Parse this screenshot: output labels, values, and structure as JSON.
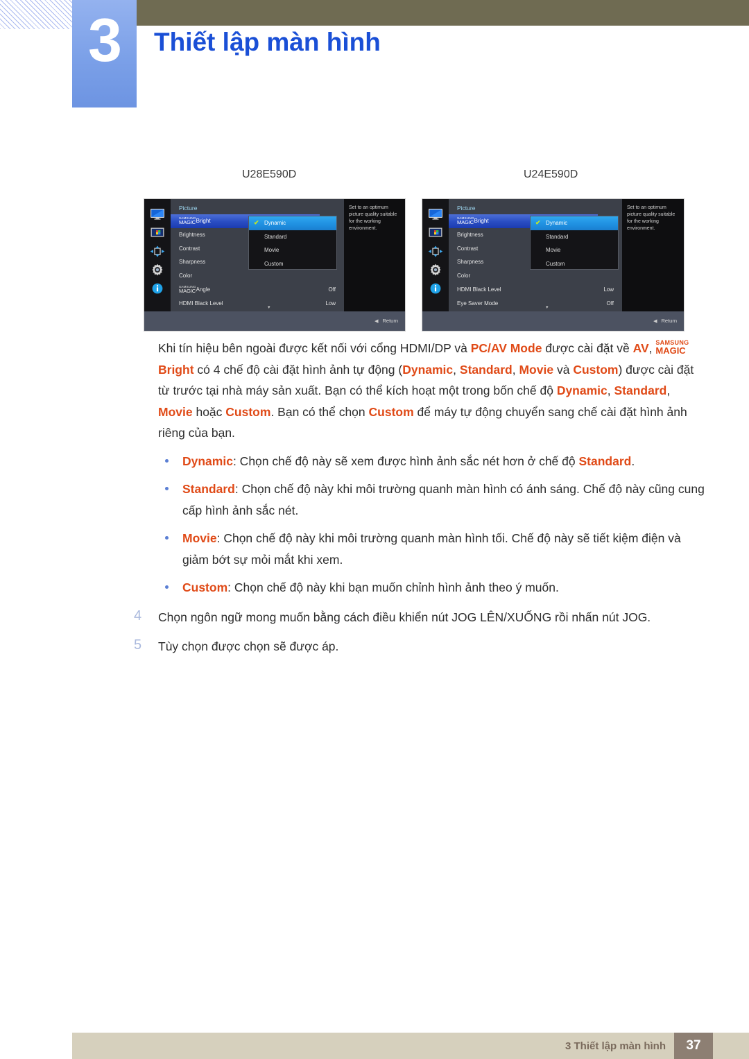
{
  "header": {
    "chapter_number": "3",
    "chapter_title": "Thiết lập màn hình",
    "accent_blue": "#1a4fd6",
    "box_blue": "#7ba0e8",
    "olive": "#6f6b52"
  },
  "models": {
    "left": "U28E590D",
    "right": "U24E590D"
  },
  "osd_left": {
    "title": "Picture",
    "rail_icons": [
      "monitor-icon",
      "picture-icon",
      "arrows-icon",
      "gear-icon",
      "info-icon"
    ],
    "rows": [
      {
        "label_small": "SAMSUNG",
        "label_big": "MAGIC",
        "suffix": "Bright",
        "value": "",
        "selected": true
      },
      {
        "label_small": "",
        "label_big": "",
        "suffix": "Brightness",
        "value": "",
        "selected": false
      },
      {
        "label_small": "",
        "label_big": "",
        "suffix": "Contrast",
        "value": "",
        "selected": false
      },
      {
        "label_small": "",
        "label_big": "",
        "suffix": "Sharpness",
        "value": "",
        "selected": false
      },
      {
        "label_small": "",
        "label_big": "",
        "suffix": "Color",
        "value": "",
        "selected": false
      },
      {
        "label_small": "SAMSUNG",
        "label_big": "MAGIC",
        "suffix": "Angle",
        "value": "Off",
        "selected": false
      },
      {
        "label_small": "",
        "label_big": "",
        "suffix": "HDMI Black Level",
        "value": "Low",
        "selected": false
      }
    ],
    "scroll_caret": "▾",
    "submenu": [
      {
        "label": "Dynamic",
        "checked": true
      },
      {
        "label": "Standard",
        "checked": false
      },
      {
        "label": "Movie",
        "checked": false
      },
      {
        "label": "Custom",
        "checked": false
      }
    ],
    "info_text": "Set to an optimum picture quality suitable for the working environment.",
    "return_label": "Return"
  },
  "osd_right": {
    "title": "Picture",
    "rail_icons": [
      "monitor-icon",
      "picture-icon",
      "arrows-icon",
      "gear-icon",
      "info-icon"
    ],
    "rows": [
      {
        "label_small": "SAMSUNG",
        "label_big": "MAGIC",
        "suffix": "Bright",
        "value": "",
        "selected": true
      },
      {
        "label_small": "",
        "label_big": "",
        "suffix": "Brightness",
        "value": "",
        "selected": false
      },
      {
        "label_small": "",
        "label_big": "",
        "suffix": "Contrast",
        "value": "",
        "selected": false
      },
      {
        "label_small": "",
        "label_big": "",
        "suffix": "Sharpness",
        "value": "",
        "selected": false
      },
      {
        "label_small": "",
        "label_big": "",
        "suffix": "Color",
        "value": "",
        "selected": false
      },
      {
        "label_small": "",
        "label_big": "",
        "suffix": "HDMI Black Level",
        "value": "Low",
        "selected": false
      },
      {
        "label_small": "",
        "label_big": "",
        "suffix": "Eye Saver Mode",
        "value": "Off",
        "selected": false
      }
    ],
    "scroll_caret": "▾",
    "submenu": [
      {
        "label": "Dynamic",
        "checked": true
      },
      {
        "label": "Standard",
        "checked": false
      },
      {
        "label": "Movie",
        "checked": false
      },
      {
        "label": "Custom",
        "checked": false
      }
    ],
    "info_text": "Set to an optimum picture quality suitable for the working environment.",
    "return_label": "Return"
  },
  "body": {
    "paragraph_lines": [
      "Khi tín hiệu bên ngoài được kết nối với cổng HDMI/DP và PC/AV Mode được cài đặt về AV,",
      "SAMSUNG MAGIC Bright có 4 chế độ cài đặt hình ảnh tự động (Dynamic, Standard, Movie và Custom)",
      "được cài đặt từ trước tại nhà máy sản xuất. Bạn có thể kích hoạt một trong bốn chế độ Dynamic,",
      "Standard, Movie hoặc Custom. Bạn có thể chọn Custom để máy tự động chuyển sang chế cài",
      "đặt hình ảnh riêng của bạn."
    ],
    "para_p1_a": "Khi tín hiệu bên ngoài được kết nối với cổng HDMI/DP và ",
    "para_p1_b": "PC/AV Mode",
    "para_p1_c": " được cài đặt về ",
    "para_p1_d": "AV",
    "para_p1_e": ", ",
    "magic_small": "SAMSUNG",
    "magic_big": "MAGIC",
    "magic_suffix": "Bright",
    "para_p2_a": " có 4 chế độ cài đặt hình ảnh tự động (",
    "para_p2_dynamic": "Dynamic",
    "para_p2_sep1": ", ",
    "para_p2_standard": "Standard",
    "para_p2_sep2": ", ",
    "para_p2_movie": "Movie",
    "para_p2_va": " và ",
    "para_p2_custom": "Custom",
    "para_p2_b": ") được cài đặt từ trước tại nhà máy sản xuất. Bạn có thể kích hoạt một trong bốn chế độ ",
    "para_p3_dynamic": "Dynamic",
    "para_p3_sep": ", ",
    "para_p3_standard": "Standard",
    "para_p3_sep2": ", ",
    "para_p3_movie": "Movie",
    "para_p3_hoac": " hoặc ",
    "para_p3_custom": "Custom",
    "para_p3_tail": ". Bạn có thể chọn ",
    "para_p4_custom": "Custom",
    "para_p4_tail": " để máy tự động chuyển sang chế cài đặt hình ảnh riêng của bạn.",
    "bullets": [
      {
        "term": "Dynamic",
        "text_before": ": Chọn chế độ này sẽ xem được hình ảnh sắc nét hơn ở chế độ ",
        "term2": "Standard",
        "text_after": "."
      },
      {
        "term": "Standard",
        "text_before": ": Chọn chế độ này khi môi trường quanh màn hình có ánh sáng. Chế độ này cũng cung cấp hình ảnh sắc nét.",
        "term2": "",
        "text_after": ""
      },
      {
        "term": "Movie",
        "text_before": ": Chọn chế độ này khi môi trường quanh màn hình tối. Chế độ này sẽ tiết kiệm điện và giảm bớt sự mỏi mắt khi xem.",
        "term2": "",
        "text_after": ""
      },
      {
        "term": "Custom",
        "text_before": ": Chọn chế độ này khi bạn muốn chỉnh hình ảnh theo ý muốn.",
        "term2": "",
        "text_after": ""
      }
    ],
    "steps": [
      {
        "num": "4",
        "text": "Chọn ngôn ngữ mong muốn bằng cách điều khiển nút JOG LÊN/XUỐNG rồi nhấn nút JOG."
      },
      {
        "num": "5",
        "text": "Tùy chọn được chọn sẽ được áp."
      }
    ]
  },
  "footer": {
    "text": "3 Thiết lập màn hình",
    "page": "37",
    "bar_color": "#d6d0bd",
    "page_box_color": "#8d7f73"
  }
}
